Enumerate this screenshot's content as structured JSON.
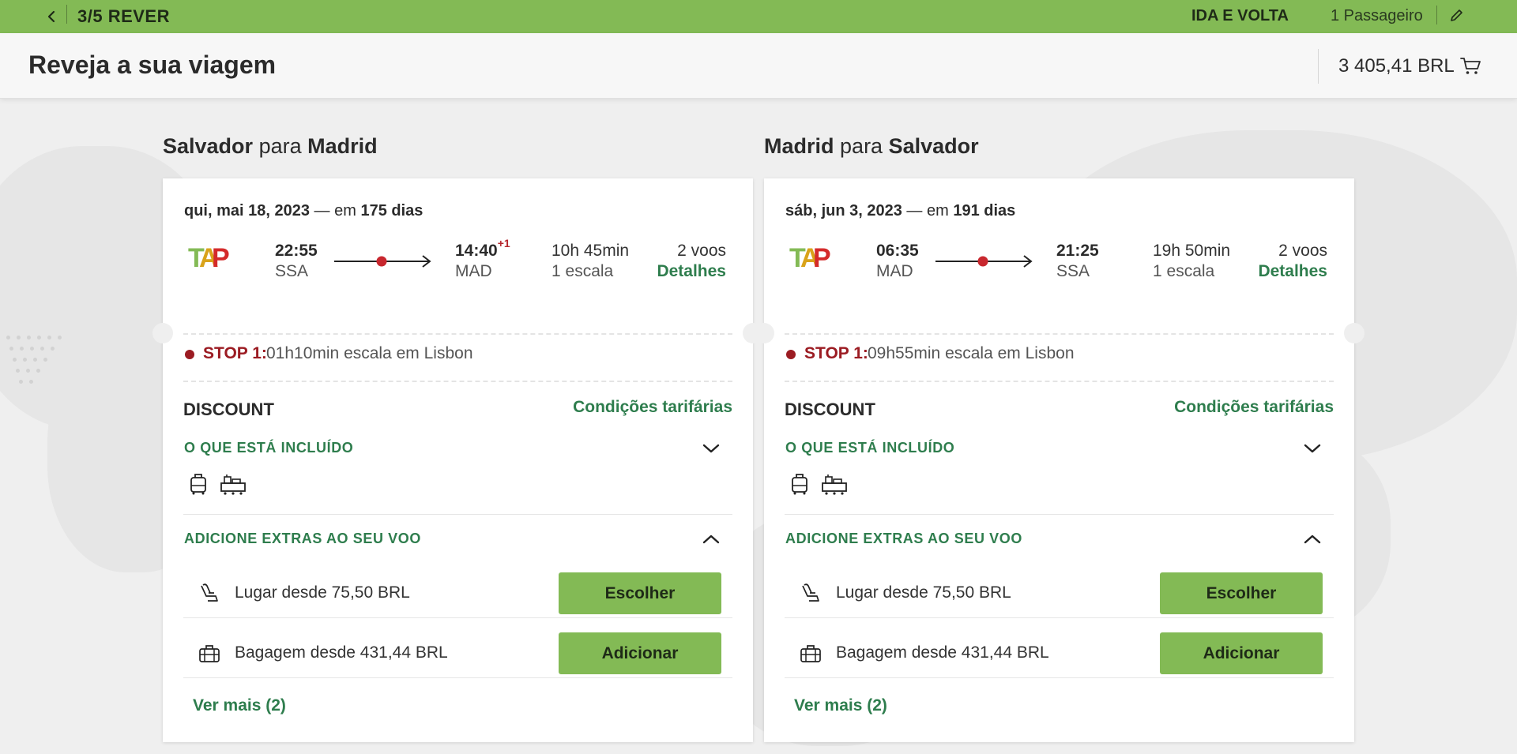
{
  "topbar": {
    "step": "3/5 REVER",
    "trip_type": "IDA E VOLTA",
    "passengers": "1 Passageiro"
  },
  "header": {
    "title": "Reveja a sua viagem",
    "total_price": "3 405,41 BRL"
  },
  "colors": {
    "brand_green": "#83ba55",
    "link_green": "#2e7d4d",
    "stop_red": "#9b1b22"
  },
  "legs": [
    {
      "origin": "Salvador",
      "connector": "para",
      "destination": "Madrid",
      "date": "qui, mai 18, 2023",
      "date_suffix": "— em",
      "days_until": "175 dias",
      "departure_time": "22:55",
      "departure_code": "SSA",
      "arrival_time": "14:40",
      "arrival_day_offset": "+1",
      "arrival_code": "MAD",
      "duration": "10h 45min",
      "stops": "1 escala",
      "flights_count": "2 voos",
      "details_label": "Detalhes",
      "stop_label": "STOP 1:",
      "stop_text": "01h10min escala em Lisbon",
      "fare_name": "DISCOUNT",
      "fare_conditions": "Condições tarifárias",
      "included_label": "O QUE ESTÁ INCLUÍDO",
      "extras_label": "ADICIONE EXTRAS AO SEU VOO",
      "seat_text": "Lugar desde 75,50 BRL",
      "seat_button": "Escolher",
      "bag_text": "Bagagem desde 431,44 BRL",
      "bag_button": "Adicionar",
      "see_more": "Ver mais (2)"
    },
    {
      "origin": "Madrid",
      "connector": "para",
      "destination": "Salvador",
      "date": "sáb, jun 3, 2023",
      "date_suffix": "— em",
      "days_until": "191 dias",
      "departure_time": "06:35",
      "departure_code": "MAD",
      "arrival_time": "21:25",
      "arrival_day_offset": "",
      "arrival_code": "SSA",
      "duration": "19h 50min",
      "stops": "1 escala",
      "flights_count": "2 voos",
      "details_label": "Detalhes",
      "stop_label": "STOP 1:",
      "stop_text": "09h55min escala em Lisbon",
      "fare_name": "DISCOUNT",
      "fare_conditions": "Condições tarifárias",
      "included_label": "O QUE ESTÁ INCLUÍDO",
      "extras_label": "ADICIONE EXTRAS AO SEU VOO",
      "seat_text": "Lugar desde 75,50 BRL",
      "seat_button": "Escolher",
      "bag_text": "Bagagem desde 431,44 BRL",
      "bag_button": "Adicionar",
      "see_more": "Ver mais (2)"
    }
  ],
  "airline_logo_text": "TAP",
  "icons": {
    "back": "chevron-left-icon",
    "edit": "pencil-icon",
    "cart": "cart-icon",
    "included": [
      "carry-on-bag-icon",
      "checked-baggage-icon"
    ],
    "seat": "seat-icon",
    "baggage": "suitcase-icon"
  }
}
